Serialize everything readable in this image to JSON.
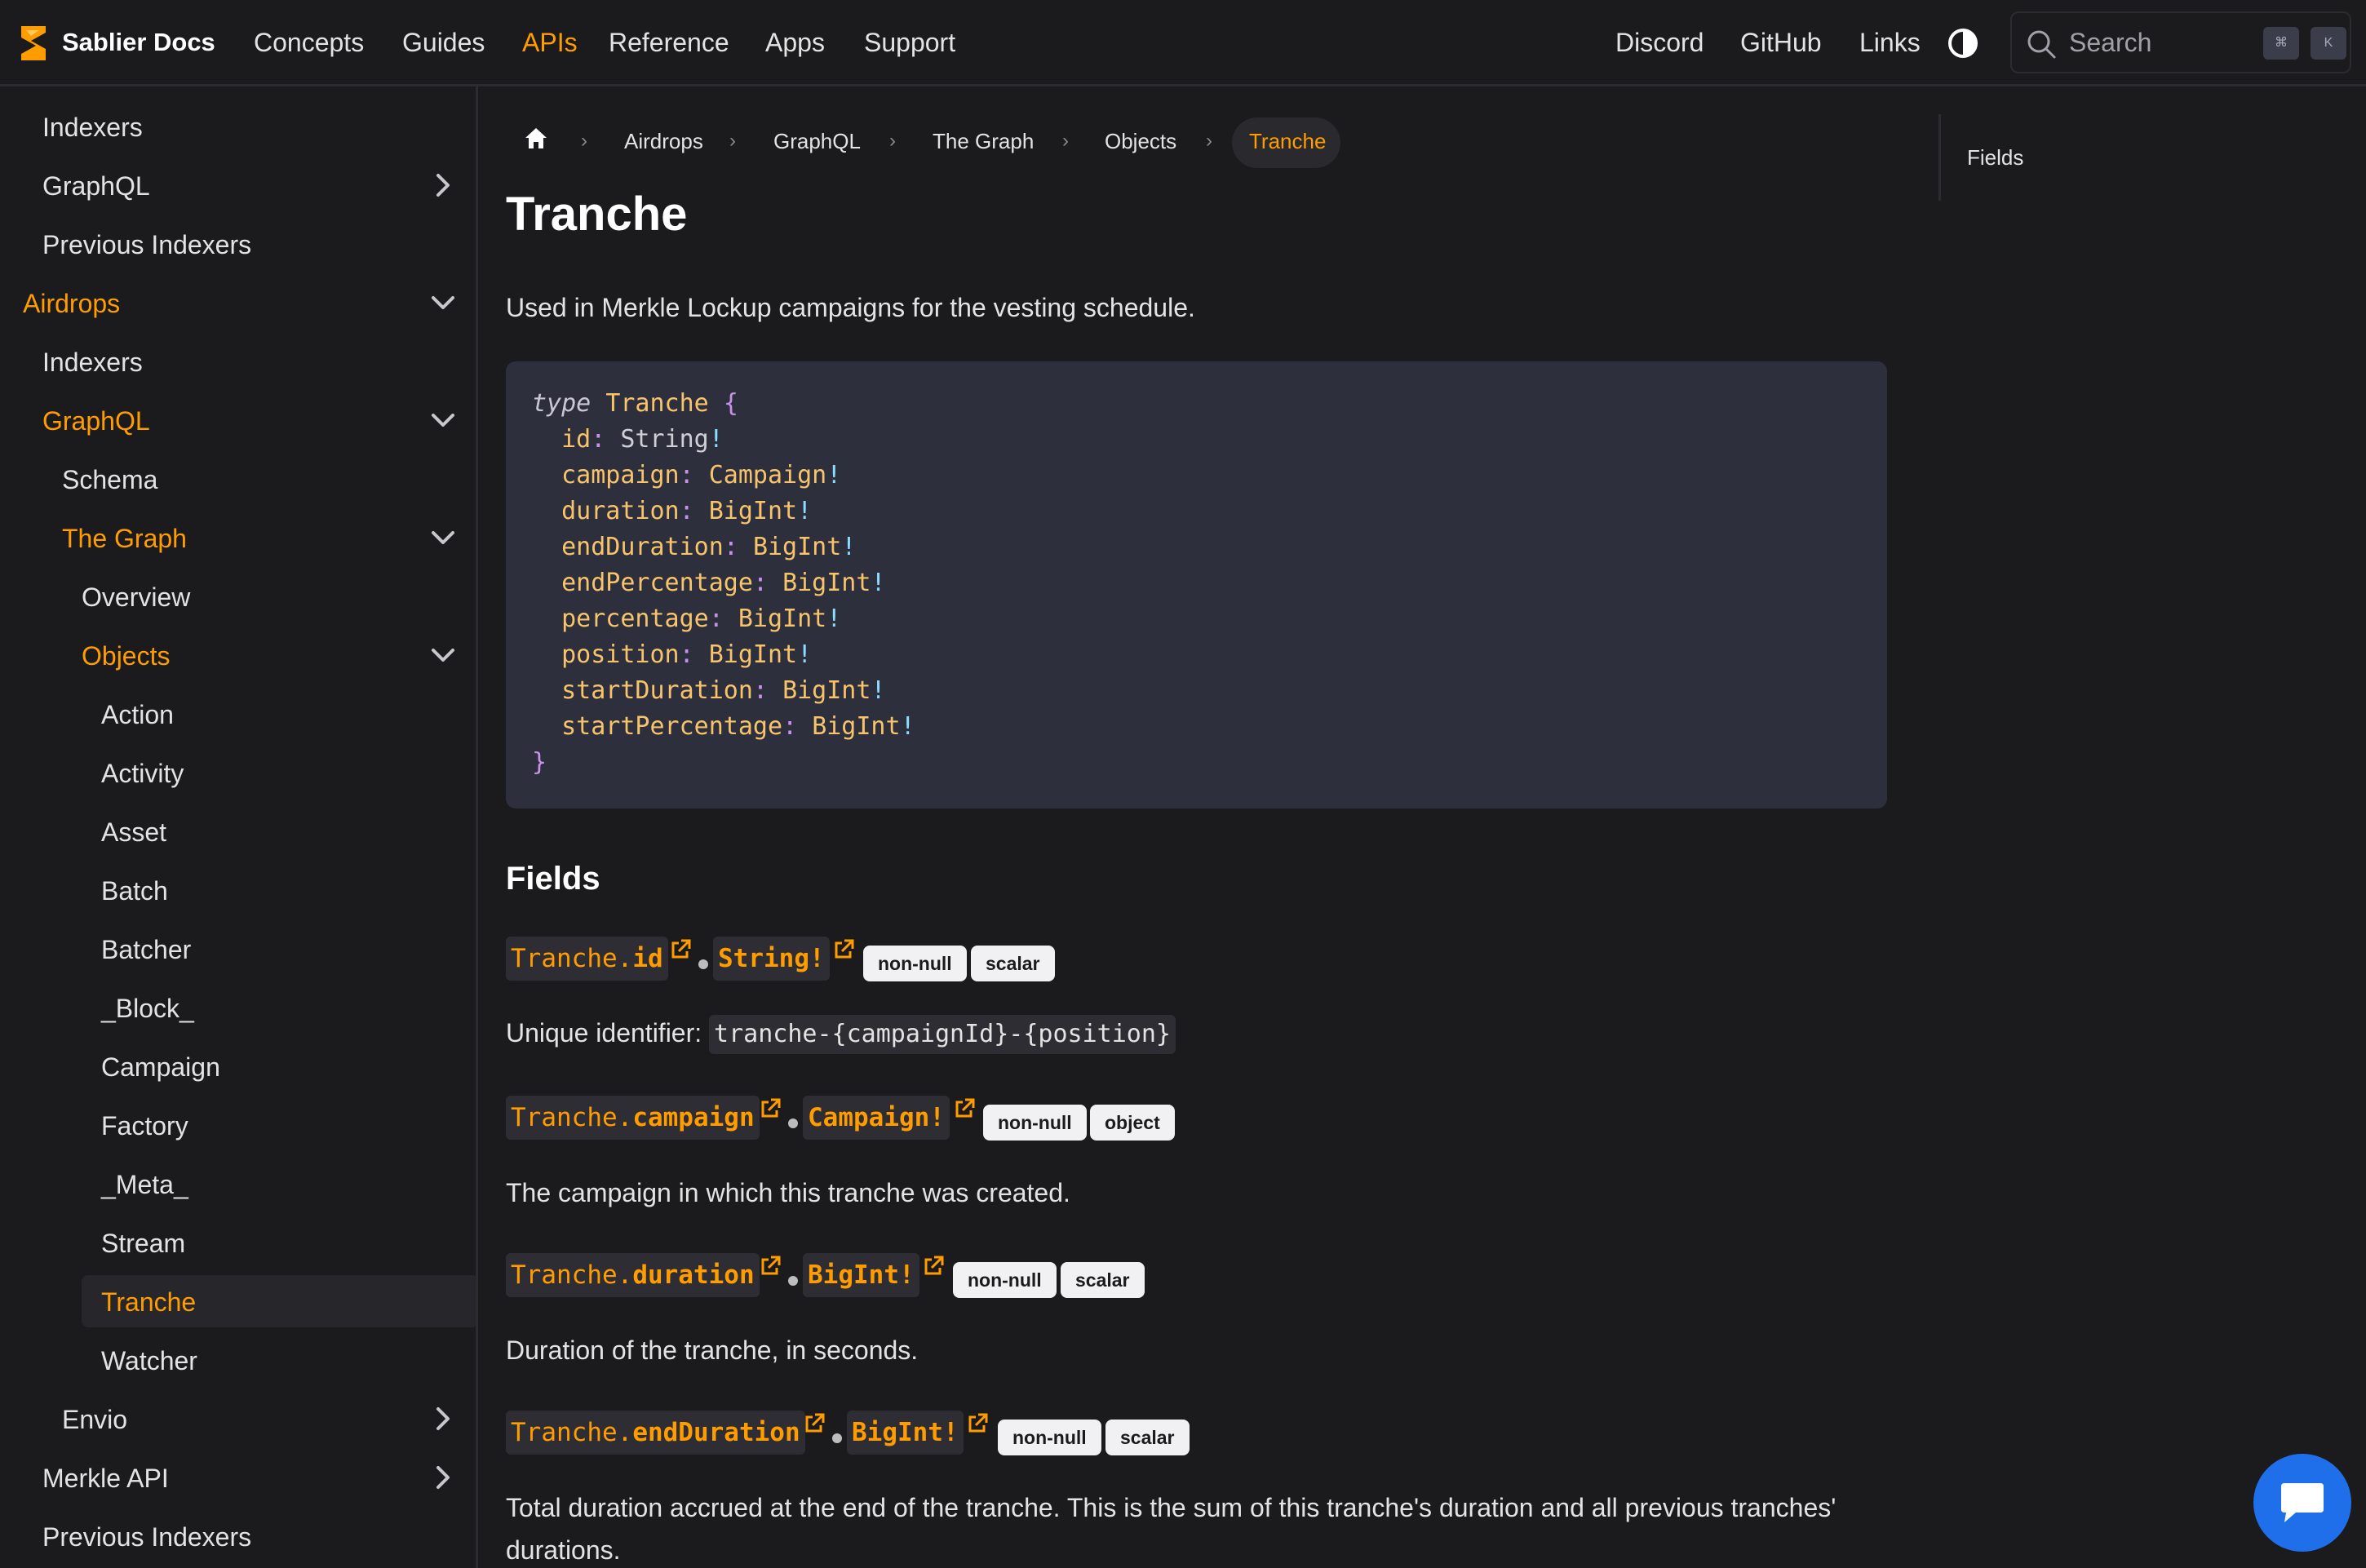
{
  "navbar": {
    "brand": "Sablier Docs",
    "links": [
      "Concepts",
      "Guides",
      "APIs",
      "Reference",
      "Apps",
      "Support"
    ],
    "right_links": [
      "Discord",
      "GitHub",
      "Links"
    ],
    "search_label": "Search",
    "kbd_keys": [
      "⌘",
      "K"
    ],
    "accent_color": "#ff9c00"
  },
  "sidebar": {
    "items": [
      {
        "label": "Indexers"
      },
      {
        "label": "GraphQL",
        "chevron": "right"
      },
      {
        "label": "Previous Indexers"
      },
      {
        "label": "Airdrops",
        "chevron": "down",
        "active": true
      },
      {
        "label": "Indexers"
      },
      {
        "label": "GraphQL",
        "chevron": "down",
        "active": true
      },
      {
        "label": "Schema"
      },
      {
        "label": "The Graph",
        "chevron": "down",
        "active": true
      },
      {
        "label": "Overview"
      },
      {
        "label": "Objects",
        "chevron": "down",
        "active": true
      },
      {
        "label": "Action"
      },
      {
        "label": "Activity"
      },
      {
        "label": "Asset"
      },
      {
        "label": "Batch"
      },
      {
        "label": "Batcher"
      },
      {
        "label": "_Block_"
      },
      {
        "label": "Campaign"
      },
      {
        "label": "Factory"
      },
      {
        "label": "_Meta_"
      },
      {
        "label": "Stream"
      },
      {
        "label": "Tranche",
        "active": true,
        "selected": true
      },
      {
        "label": "Watcher"
      },
      {
        "label": "Envio",
        "chevron": "right"
      },
      {
        "label": "Merkle API",
        "chevron": "right"
      },
      {
        "label": "Previous Indexers"
      }
    ]
  },
  "breadcrumb": {
    "items": [
      "Airdrops",
      "GraphQL",
      "The Graph",
      "Objects",
      "Tranche"
    ]
  },
  "page": {
    "title": "Tranche",
    "description": "Used in Merkle Lockup campaigns for the vesting schedule."
  },
  "code": {
    "keyword": "type",
    "type_name": "Tranche",
    "open_brace": "{",
    "close_brace": "}",
    "fields": [
      {
        "name": "id",
        "type": "String"
      },
      {
        "name": "campaign",
        "type": "Campaign"
      },
      {
        "name": "duration",
        "type": "BigInt"
      },
      {
        "name": "endDuration",
        "type": "BigInt"
      },
      {
        "name": "endPercentage",
        "type": "BigInt"
      },
      {
        "name": "percentage",
        "type": "BigInt"
      },
      {
        "name": "position",
        "type": "BigInt"
      },
      {
        "name": "startDuration",
        "type": "BigInt"
      },
      {
        "name": "startPercentage",
        "type": "BigInt"
      }
    ]
  },
  "fields_section": {
    "heading": "Fields",
    "fields": [
      {
        "prefix": "Tranche.",
        "name": "id",
        "type": "String!",
        "badges": [
          "non-null",
          "scalar"
        ],
        "desc_prefix": "Unique identifier: ",
        "desc_code": "tranche-{campaignId}-{position}"
      },
      {
        "prefix": "Tranche.",
        "name": "campaign",
        "type": "Campaign!",
        "badges": [
          "non-null",
          "object"
        ],
        "description": "The campaign in which this tranche was created."
      },
      {
        "prefix": "Tranche.",
        "name": "duration",
        "type": "BigInt!",
        "badges": [
          "non-null",
          "scalar"
        ],
        "description": "Duration of the tranche, in seconds."
      },
      {
        "prefix": "Tranche.",
        "name": "endDuration",
        "type": "BigInt!",
        "badges": [
          "non-null",
          "scalar"
        ],
        "description_line1": "Total duration accrued at the end of the tranche. This is the sum of this tranche's duration and all previous tranches'",
        "description_line2": "durations."
      }
    ]
  },
  "toc": {
    "items": [
      "Fields"
    ]
  }
}
